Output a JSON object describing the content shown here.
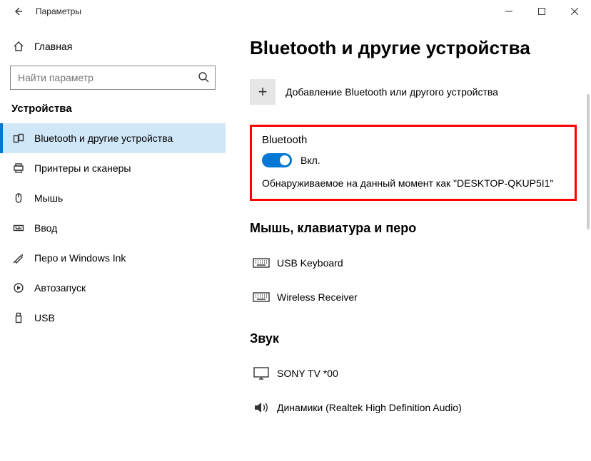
{
  "titlebar": {
    "title": "Параметры"
  },
  "sidebar": {
    "home_label": "Главная",
    "search_placeholder": "Найти параметр",
    "category": "Устройства",
    "items": [
      {
        "label": "Bluetooth и другие устройства",
        "icon": "bluetooth-devices-icon",
        "active": true
      },
      {
        "label": "Принтеры и сканеры",
        "icon": "printer-icon",
        "active": false
      },
      {
        "label": "Мышь",
        "icon": "mouse-icon",
        "active": false
      },
      {
        "label": "Ввод",
        "icon": "keyboard-icon",
        "active": false
      },
      {
        "label": "Перо и Windows Ink",
        "icon": "pen-icon",
        "active": false
      },
      {
        "label": "Автозапуск",
        "icon": "autoplay-icon",
        "active": false
      },
      {
        "label": "USB",
        "icon": "usb-icon",
        "active": false
      }
    ]
  },
  "main": {
    "page_title": "Bluetooth и другие устройства",
    "add_device_label": "Добавление Bluetooth или другого устройства",
    "bluetooth": {
      "heading": "Bluetooth",
      "toggle_label": "Вкл.",
      "discoverable_text": "Обнаруживаемое на данный момент как \"DESKTOP-QKUP5I1\""
    },
    "sections": [
      {
        "heading": "Мышь, клавиатура и перо",
        "devices": [
          {
            "label": "USB Keyboard",
            "icon": "device-keyboard-icon"
          },
          {
            "label": "Wireless Receiver",
            "icon": "device-keyboard-icon"
          }
        ]
      },
      {
        "heading": "Звук",
        "devices": [
          {
            "label": "SONY TV  *00",
            "icon": "device-monitor-icon"
          },
          {
            "label": "Динамики (Realtek High Definition Audio)",
            "icon": "device-speaker-icon"
          }
        ]
      }
    ]
  }
}
